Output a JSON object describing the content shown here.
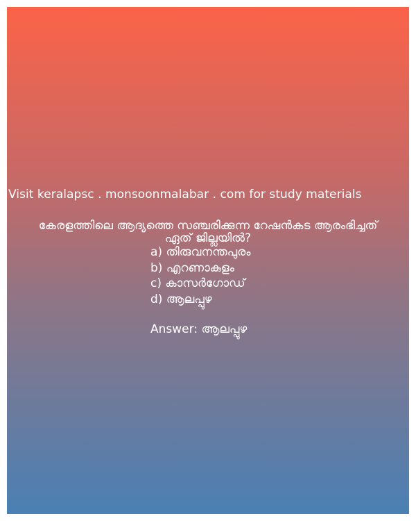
{
  "promo_text": "Visit keralapsc . monsoonmalabar . com for study materials",
  "question": {
    "line1": "കേരളത്തിലെ ആദ്യത്തെ സഞ്ചരിക്കുന്ന റേഷൻകട ആരംഭിച്ചത്",
    "line2": "ഏത് ജില്ലയിൽ?"
  },
  "options": [
    "a) തിരുവനന്തപുരം",
    "b) എറണാകുളം",
    "c) കാസർഗോഡ്",
    "d) ആലപ്പുഴ"
  ],
  "answer": {
    "label": "Answer: ",
    "value": "ആലപ്പുഴ"
  },
  "colors": {
    "gradient_top": "#fb6348",
    "gradient_bottom": "#4a80b4",
    "text": "#ffffff"
  }
}
